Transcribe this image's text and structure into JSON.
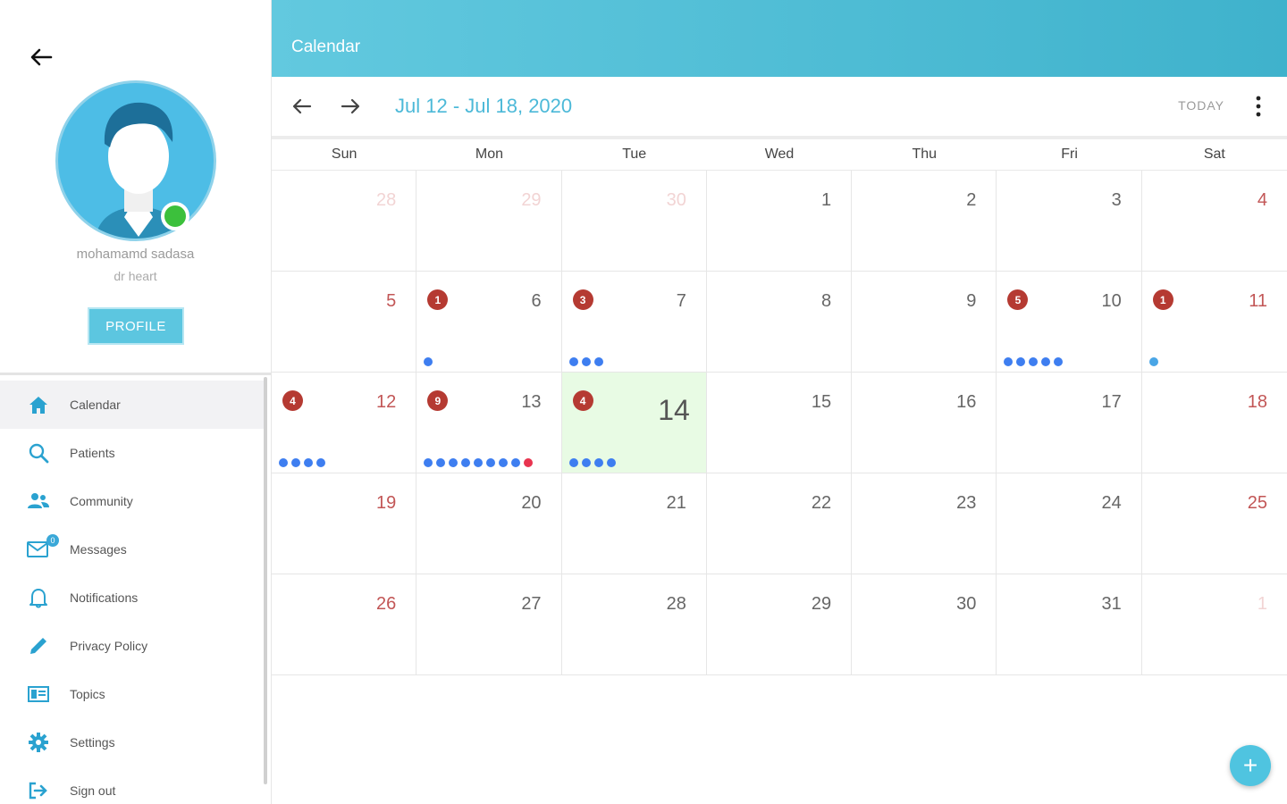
{
  "header": {
    "title": "Calendar"
  },
  "user": {
    "name": "mohamamd sadasa",
    "role": "dr heart",
    "profile_label": "PROFILE"
  },
  "nav": [
    {
      "id": "calendar",
      "label": "Calendar",
      "icon": "home-icon",
      "active": true
    },
    {
      "id": "patients",
      "label": "Patients",
      "icon": "search-icon"
    },
    {
      "id": "community",
      "label": "Community",
      "icon": "people-icon"
    },
    {
      "id": "messages",
      "label": "Messages",
      "icon": "mail-icon",
      "badge": "0"
    },
    {
      "id": "notifications",
      "label": "Notifications",
      "icon": "bell-icon"
    },
    {
      "id": "privacy",
      "label": "Privacy Policy",
      "icon": "pencil-icon"
    },
    {
      "id": "topics",
      "label": "Topics",
      "icon": "topics-icon"
    },
    {
      "id": "settings",
      "label": "Settings",
      "icon": "gear-icon"
    },
    {
      "id": "signout",
      "label": "Sign out",
      "icon": "sign-out-icon"
    }
  ],
  "toolbar": {
    "range": "Jul 12 - Jul 18, 2020",
    "today_label": "TODAY"
  },
  "weekdays": [
    "Sun",
    "Mon",
    "Tue",
    "Wed",
    "Thu",
    "Fri",
    "Sat"
  ],
  "colors": {
    "accent": "#4cb9d8",
    "today_bg": "#e8fbe4",
    "badge": "#b53a32",
    "event_dot": "#3e7ef0",
    "weekend_text": "#c25656"
  },
  "days": [
    {
      "day": "28",
      "faded": true
    },
    {
      "day": "29",
      "faded": true
    },
    {
      "day": "30",
      "faded": true
    },
    {
      "day": "1"
    },
    {
      "day": "2"
    },
    {
      "day": "3"
    },
    {
      "day": "4"
    },
    {
      "day": "5"
    },
    {
      "day": "6",
      "badge": "1",
      "dots": [
        "blue"
      ]
    },
    {
      "day": "7",
      "badge": "3",
      "dots": [
        "blue",
        "blue",
        "blue"
      ]
    },
    {
      "day": "8"
    },
    {
      "day": "9"
    },
    {
      "day": "10",
      "badge": "5",
      "dots": [
        "blue",
        "blue",
        "blue",
        "blue",
        "blue"
      ]
    },
    {
      "day": "11",
      "badge": "1",
      "dots": [
        "light"
      ]
    },
    {
      "day": "12",
      "badge": "4",
      "dots": [
        "blue",
        "blue",
        "blue",
        "blue"
      ]
    },
    {
      "day": "13",
      "badge": "9",
      "dots": [
        "blue",
        "blue",
        "blue",
        "blue",
        "blue",
        "blue",
        "blue",
        "blue",
        "red"
      ]
    },
    {
      "day": "14",
      "badge": "4",
      "dots": [
        "blue",
        "blue",
        "blue",
        "blue"
      ],
      "today": true
    },
    {
      "day": "15"
    },
    {
      "day": "16"
    },
    {
      "day": "17"
    },
    {
      "day": "18"
    },
    {
      "day": "19"
    },
    {
      "day": "20"
    },
    {
      "day": "21"
    },
    {
      "day": "22"
    },
    {
      "day": "23"
    },
    {
      "day": "24"
    },
    {
      "day": "25"
    },
    {
      "day": "26"
    },
    {
      "day": "27"
    },
    {
      "day": "28"
    },
    {
      "day": "29"
    },
    {
      "day": "30"
    },
    {
      "day": "31"
    },
    {
      "day": "1",
      "faded": true
    }
  ],
  "fab_label": "+"
}
